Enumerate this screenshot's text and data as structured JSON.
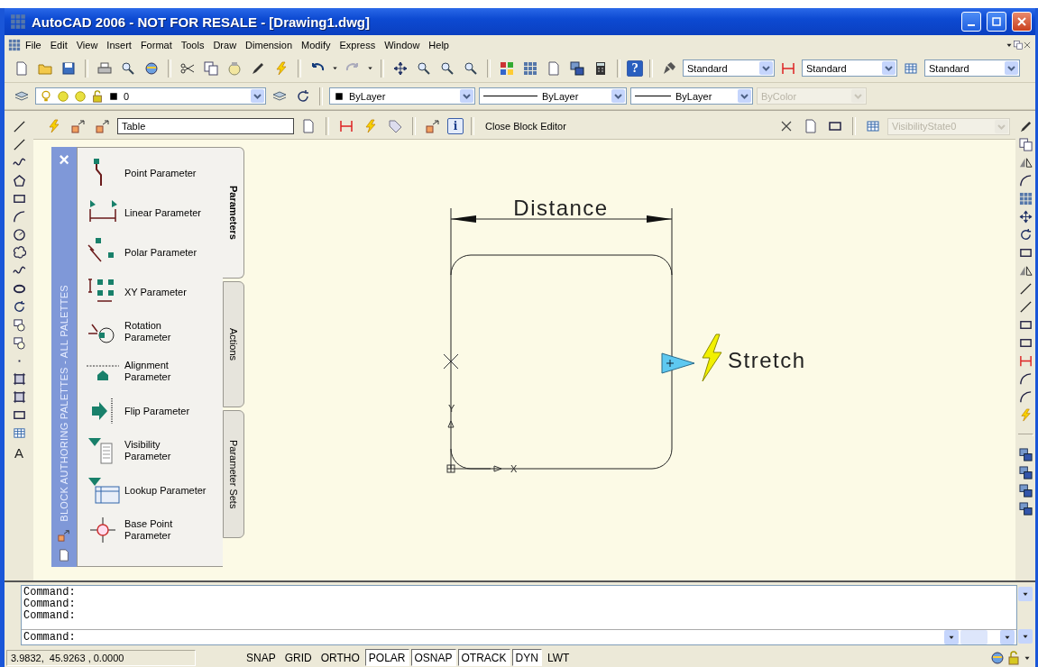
{
  "window": {
    "title": "AutoCAD 2006 - NOT FOR RESALE - [Drawing1.dwg]"
  },
  "menu": [
    "File",
    "Edit",
    "View",
    "Insert",
    "Format",
    "Tools",
    "Draw",
    "Dimension",
    "Modify",
    "Express",
    "Window",
    "Help"
  ],
  "standard_toolbar": {
    "help_glyph": "?"
  },
  "style_dropdowns": [
    {
      "value": "Standard"
    },
    {
      "value": "Standard"
    },
    {
      "value": "Standard"
    }
  ],
  "layers_toolbar": {
    "layer": "0",
    "color_control": "ByLayer",
    "linetype": "ByLayer",
    "lineweight": "ByLayer",
    "plot_style": {
      "value": "ByColor",
      "disabled": true
    }
  },
  "block_editor_toolbar": {
    "block_name": "Table",
    "info_glyph": "i",
    "close_label": "Close Block Editor",
    "visibility_state": {
      "value": "VisibilityState0",
      "disabled": true
    }
  },
  "draw_toolbar": {
    "text_glyph": "A"
  },
  "palette": {
    "close_glyph": "×",
    "title": "BLOCK AUTHORING PALETTES - ALL PALETTES",
    "tabs": [
      {
        "label": "Parameters",
        "selected": true
      },
      {
        "label": "Actions",
        "selected": false
      },
      {
        "label": "Parameter Sets",
        "selected": false
      }
    ],
    "items": [
      {
        "label": "Point Parameter"
      },
      {
        "label": "Linear Parameter"
      },
      {
        "label": "Polar Parameter"
      },
      {
        "label": "XY Parameter"
      },
      {
        "label": "Rotation\nParameter"
      },
      {
        "label": "Alignment\nParameter"
      },
      {
        "label": "Flip Parameter"
      },
      {
        "label": "Visibility\nParameter"
      },
      {
        "label": "Lookup Parameter"
      },
      {
        "label": "Base Point\nParameter"
      }
    ]
  },
  "drawing": {
    "dimension_label": "Distance",
    "action_label": "Stretch",
    "ucs_x_label": "X",
    "ucs_y_label": "Y"
  },
  "command_history": [
    "Command:",
    "Command:",
    "Command:"
  ],
  "command_prompt": "Command:",
  "status_bar": {
    "coordinates": "3.9832,  45.9263 , 0.0000",
    "toggles": [
      {
        "label": "SNAP",
        "on": false
      },
      {
        "label": "GRID",
        "on": false
      },
      {
        "label": "ORTHO",
        "on": false
      },
      {
        "label": "POLAR",
        "on": true
      },
      {
        "label": "OSNAP",
        "on": true
      },
      {
        "label": "OTRACK",
        "on": true
      },
      {
        "label": "DYN",
        "on": true
      },
      {
        "label": "LWT",
        "on": false
      }
    ]
  }
}
